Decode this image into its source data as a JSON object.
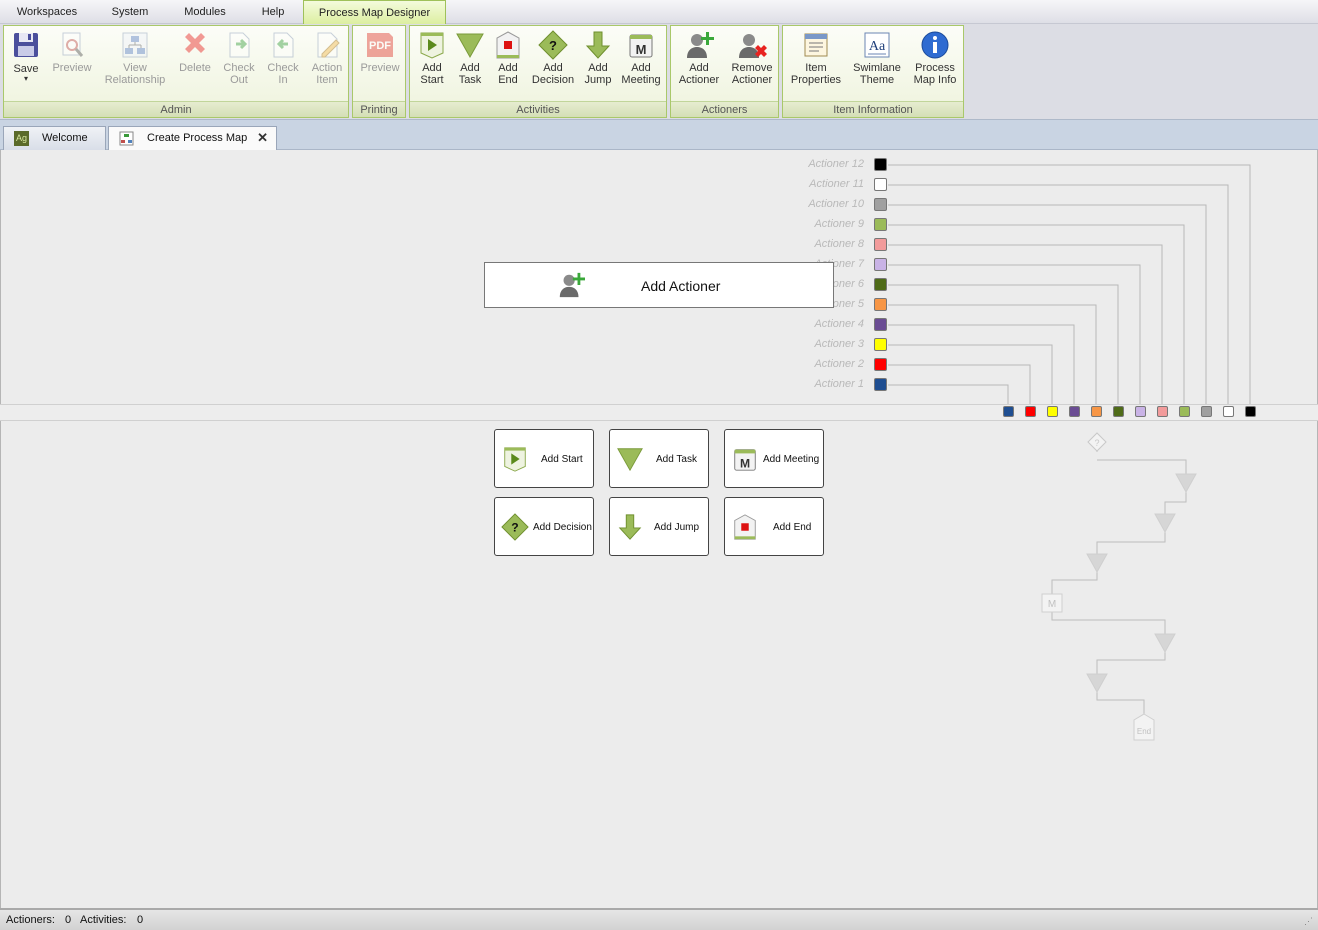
{
  "menu": {
    "items": [
      {
        "label": "Workspaces"
      },
      {
        "label": "System"
      },
      {
        "label": "Modules"
      },
      {
        "label": "Help"
      },
      {
        "label": "Process Map Designer"
      }
    ]
  },
  "ribbon": {
    "admin": {
      "label": "Admin",
      "save": [
        "Save"
      ],
      "preview": [
        "Preview"
      ],
      "view_relationship": [
        "View",
        "Relationship"
      ],
      "delete": [
        "Delete"
      ],
      "check_out": [
        "Check",
        "Out"
      ],
      "check_in": [
        "Check",
        "In"
      ],
      "action_item": [
        "Action",
        "Item"
      ]
    },
    "printing": {
      "label": "Printing",
      "preview": [
        "Preview"
      ],
      "pdf_text": "PDF"
    },
    "activities": {
      "label": "Activities",
      "add_start": [
        "Add",
        "Start"
      ],
      "add_task": [
        "Add",
        "Task"
      ],
      "add_end": [
        "Add",
        "End"
      ],
      "add_decision": [
        "Add",
        "Decision"
      ],
      "add_jump": [
        "Add",
        "Jump"
      ],
      "add_meeting": [
        "Add",
        "Meeting"
      ]
    },
    "actioners": {
      "label": "Actioners",
      "add_actioner": [
        "Add",
        "Actioner"
      ],
      "remove_actioner": [
        "Remove",
        "Actioner"
      ]
    },
    "item_information": {
      "label": "Item Information",
      "item_properties": [
        "Item",
        "Properties"
      ],
      "swimlane_theme": [
        "Swimlane",
        "Theme"
      ],
      "process_map_info": [
        "Process",
        "Map Info"
      ]
    }
  },
  "tabs": [
    {
      "label": "Welcome",
      "icon_text": "Ag"
    },
    {
      "label": "Create Process Map",
      "close": "✕"
    }
  ],
  "canvas": {
    "add_actioner_label": "Add Actioner",
    "palette": {
      "add_start": "Add Start",
      "add_task": "Add Task",
      "add_meeting": "Add Meeting",
      "add_decision": "Add Decision",
      "add_jump": "Add Jump",
      "add_end": "Add End"
    },
    "actioners": [
      {
        "label": "Actioner 12",
        "color": "#000000"
      },
      {
        "label": "Actioner 11",
        "color": "#ffffff"
      },
      {
        "label": "Actioner 10",
        "color": "#a0a0a0"
      },
      {
        "label": "Actioner 9",
        "color": "#9bbb59"
      },
      {
        "label": "Actioner 8",
        "color": "#f29b9b"
      },
      {
        "label": "Actioner 7",
        "color": "#c9b3e6"
      },
      {
        "label": "Actioner 6",
        "color": "#4f6b18"
      },
      {
        "label": "Actioner 5",
        "color": "#f79646"
      },
      {
        "label": "Actioner 4",
        "color": "#6a4c93"
      },
      {
        "label": "Actioner 3",
        "color": "#ffff00"
      },
      {
        "label": "Actioner 2",
        "color": "#ff0000"
      },
      {
        "label": "Actioner 1",
        "color": "#1f4e91"
      }
    ],
    "preview_meeting_letter": "M",
    "preview_decision_mark": "?",
    "preview_end_label": "End"
  },
  "status": {
    "actioners_label": "Actioners:",
    "actioners_count": "0",
    "activities_label": "Activities:",
    "activities_count": "0"
  }
}
